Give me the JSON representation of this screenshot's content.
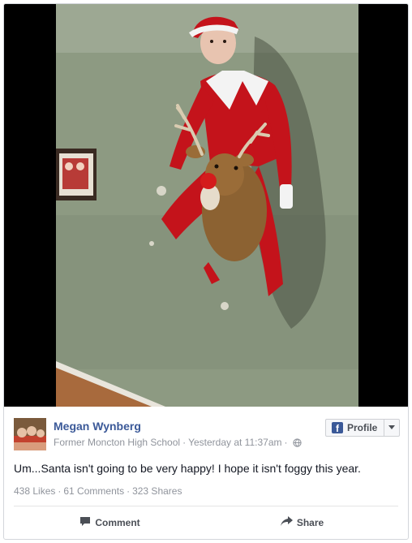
{
  "post": {
    "author": "Megan Wynberg",
    "school": "Former Moncton High School",
    "timestamp": "Yesterday at 11:37am",
    "separator": "·",
    "privacy_icon": "globe-icon",
    "caption": "Um...Santa isn't going to be very happy! I hope it isn't foggy this year.",
    "photo_icon": "elf-on-reindeer-photo"
  },
  "profile_button": {
    "label": "Profile",
    "logo": "f",
    "icon": "facebook-logo-icon",
    "caret_icon": "caret-down-icon"
  },
  "stats": {
    "likes": "438 Likes",
    "comments": "61 Comments",
    "shares": "323 Shares",
    "separator": "·"
  },
  "actions": {
    "comment": "Comment",
    "comment_icon": "comment-icon",
    "share": "Share",
    "share_icon": "share-icon"
  },
  "colors": {
    "brand": "#3b5998",
    "meta_text": "#90949c",
    "body_text": "#141823",
    "action_text": "#4b4f56"
  }
}
